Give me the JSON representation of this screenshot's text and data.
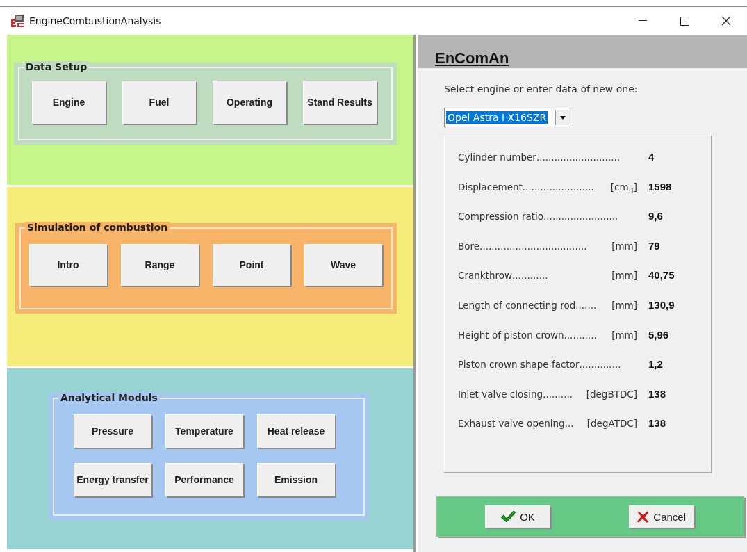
{
  "window": {
    "title": "EngineCombustionAnalysis"
  },
  "sections": [
    {
      "title": "Data Setup",
      "color": "#c6f58a",
      "buttons": [
        "Engine",
        "Fuel",
        "Operating",
        "Stand Results"
      ]
    },
    {
      "title": "Simulation of combustion",
      "color": "#f5ec7a",
      "buttons": [
        "Intro",
        "Range",
        "Point",
        "Wave"
      ]
    },
    {
      "title": "Analytical Moduls",
      "color": "#97d3d3",
      "buttons": [
        "Pressure",
        "Temperature",
        "Heat release",
        "Energy transfer",
        "Performance",
        "Emission"
      ]
    }
  ],
  "dialog": {
    "heading": "EnComAn",
    "prompt": "Select engine or enter data of new one:",
    "engine_select": {
      "value": "Opel Astra I X16SZR"
    },
    "parameters": [
      {
        "name": "Cylinder number",
        "leader": "............................",
        "value": "4"
      },
      {
        "name": "Displacement",
        "leader": "........................",
        "unit": "[cm$_{3}$]",
        "value": "1598"
      },
      {
        "name": "Compression ratio",
        "leader": ".........................",
        "value": "9,6"
      },
      {
        "name": "Bore",
        "leader": "....................................",
        "unit": "[mm]",
        "value": "79"
      },
      {
        "name": "Crankthrow",
        "leader": "............",
        "unit": "[mm]",
        "value": "40,75"
      },
      {
        "name": "Length of connecting rod",
        "leader": ".......",
        "unit": "[mm]",
        "value": "130,9"
      },
      {
        "name": "Height of piston crown",
        "leader": "...........",
        "unit": "[mm]",
        "value": "5,96"
      },
      {
        "name": "Piston crown shape factor",
        "leader": "..............",
        "value": "1,2"
      },
      {
        "name": "Inlet valve closing",
        "leader": "..........",
        "unit": "[degBTDC]",
        "value": "138"
      },
      {
        "name": "Exhaust valve opening",
        "leader": "...",
        "unit": "[degATDC]",
        "value": "138"
      }
    ],
    "buttons": [
      {
        "kind": "ok",
        "label": "OK"
      },
      {
        "kind": "cancel",
        "label": "Cancel"
      }
    ]
  }
}
